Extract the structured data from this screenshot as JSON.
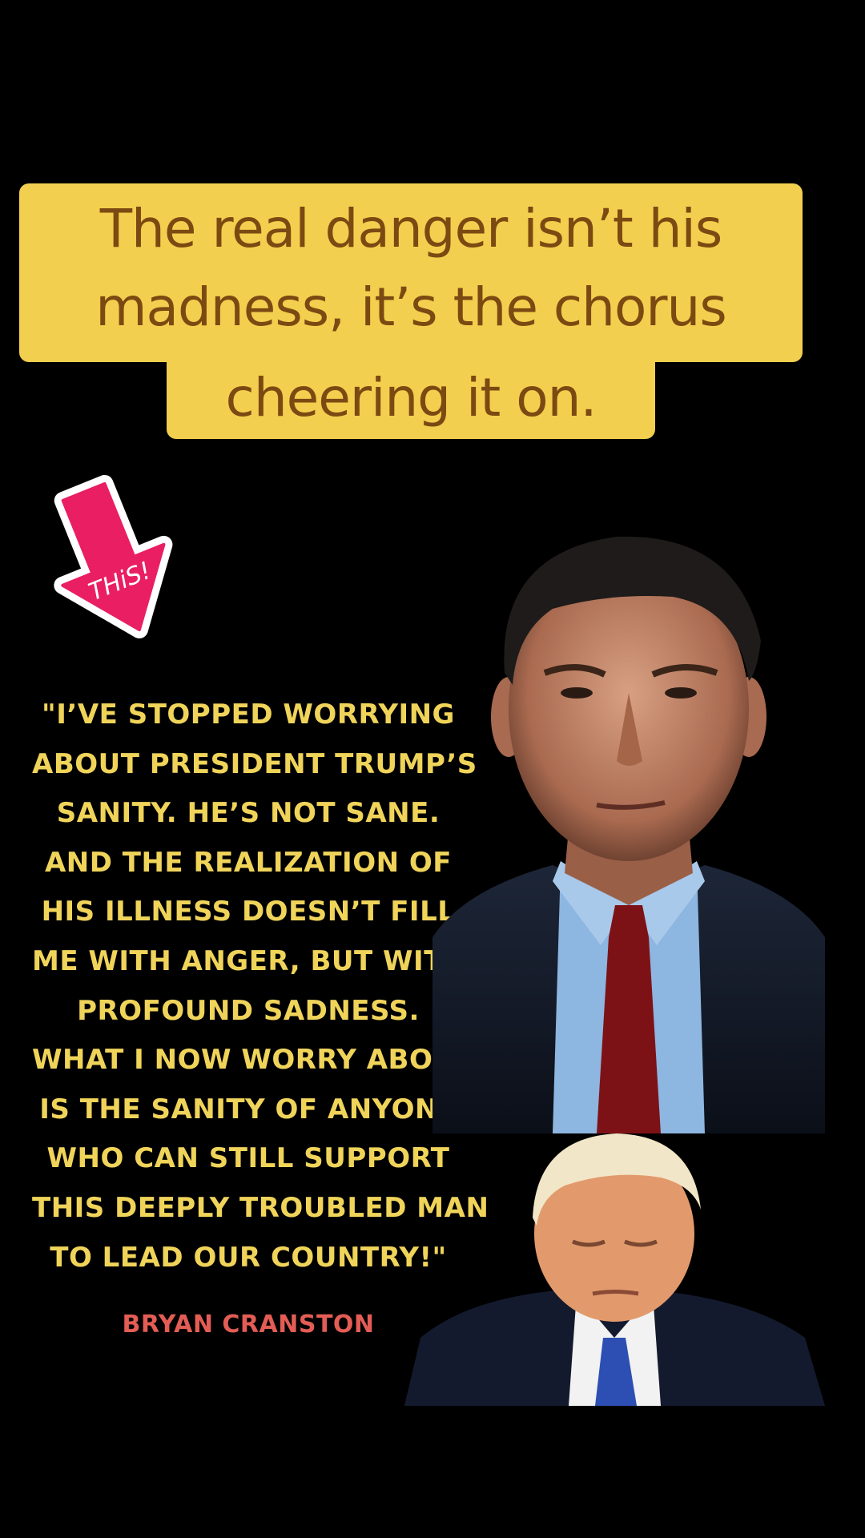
{
  "caption": {
    "lines": [
      "The real danger isn’t his",
      "madness, it’s the chorus",
      "cheering it on."
    ]
  },
  "sticker": {
    "text": "THiS!",
    "color": "#e91e63"
  },
  "quote": {
    "lines": [
      "\"I’ve stopped worrying",
      "about President Trump’s",
      "sanity. He’s not sane.",
      "And the realization of",
      "his illness doesn’t fill",
      "me with anger, but with",
      "profound sadness.",
      "What I now worry about",
      "is the sanity of anyone",
      "who can STILL support",
      "this deeply troubled man",
      "to lead our country!\""
    ],
    "color": "#f0d45a"
  },
  "attribution": {
    "name": "Bryan Cranston",
    "color": "#e35d55"
  },
  "colors": {
    "background": "#000000",
    "caption_bg": "#f2cf4e",
    "caption_text": "#7a4a12"
  }
}
